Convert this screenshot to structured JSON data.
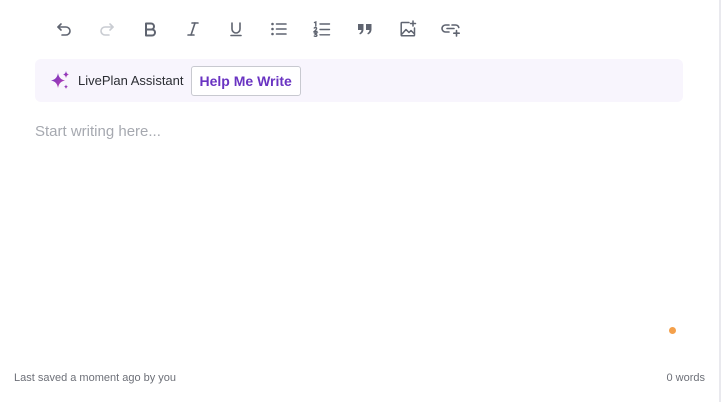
{
  "toolbar": {
    "buttons": [
      {
        "name": "undo",
        "icon": "undo-icon",
        "enabled": true
      },
      {
        "name": "redo",
        "icon": "redo-icon",
        "enabled": false
      },
      {
        "name": "bold",
        "icon": "bold-icon",
        "enabled": true
      },
      {
        "name": "italic",
        "icon": "italic-icon",
        "enabled": true
      },
      {
        "name": "underline",
        "icon": "underline-icon",
        "enabled": true
      },
      {
        "name": "bullet-list",
        "icon": "bullet-list-icon",
        "enabled": true
      },
      {
        "name": "numbered-list",
        "icon": "numbered-list-icon",
        "enabled": true
      },
      {
        "name": "quote",
        "icon": "quote-icon",
        "enabled": true
      },
      {
        "name": "insert-image",
        "icon": "image-add-icon",
        "enabled": true
      },
      {
        "name": "insert-link",
        "icon": "link-add-icon",
        "enabled": true
      }
    ]
  },
  "assistant": {
    "icon": "sparkle-icon",
    "label": "LivePlan Assistant",
    "button_label": "Help Me Write",
    "accent_color": "#6a34c2",
    "bar_color": "#f8f5fd"
  },
  "editor": {
    "placeholder": "Start writing here..."
  },
  "status": {
    "dot_color": "#f4a04b"
  },
  "footer": {
    "last_saved": "Last saved a moment ago by you",
    "word_count": "0 words"
  }
}
